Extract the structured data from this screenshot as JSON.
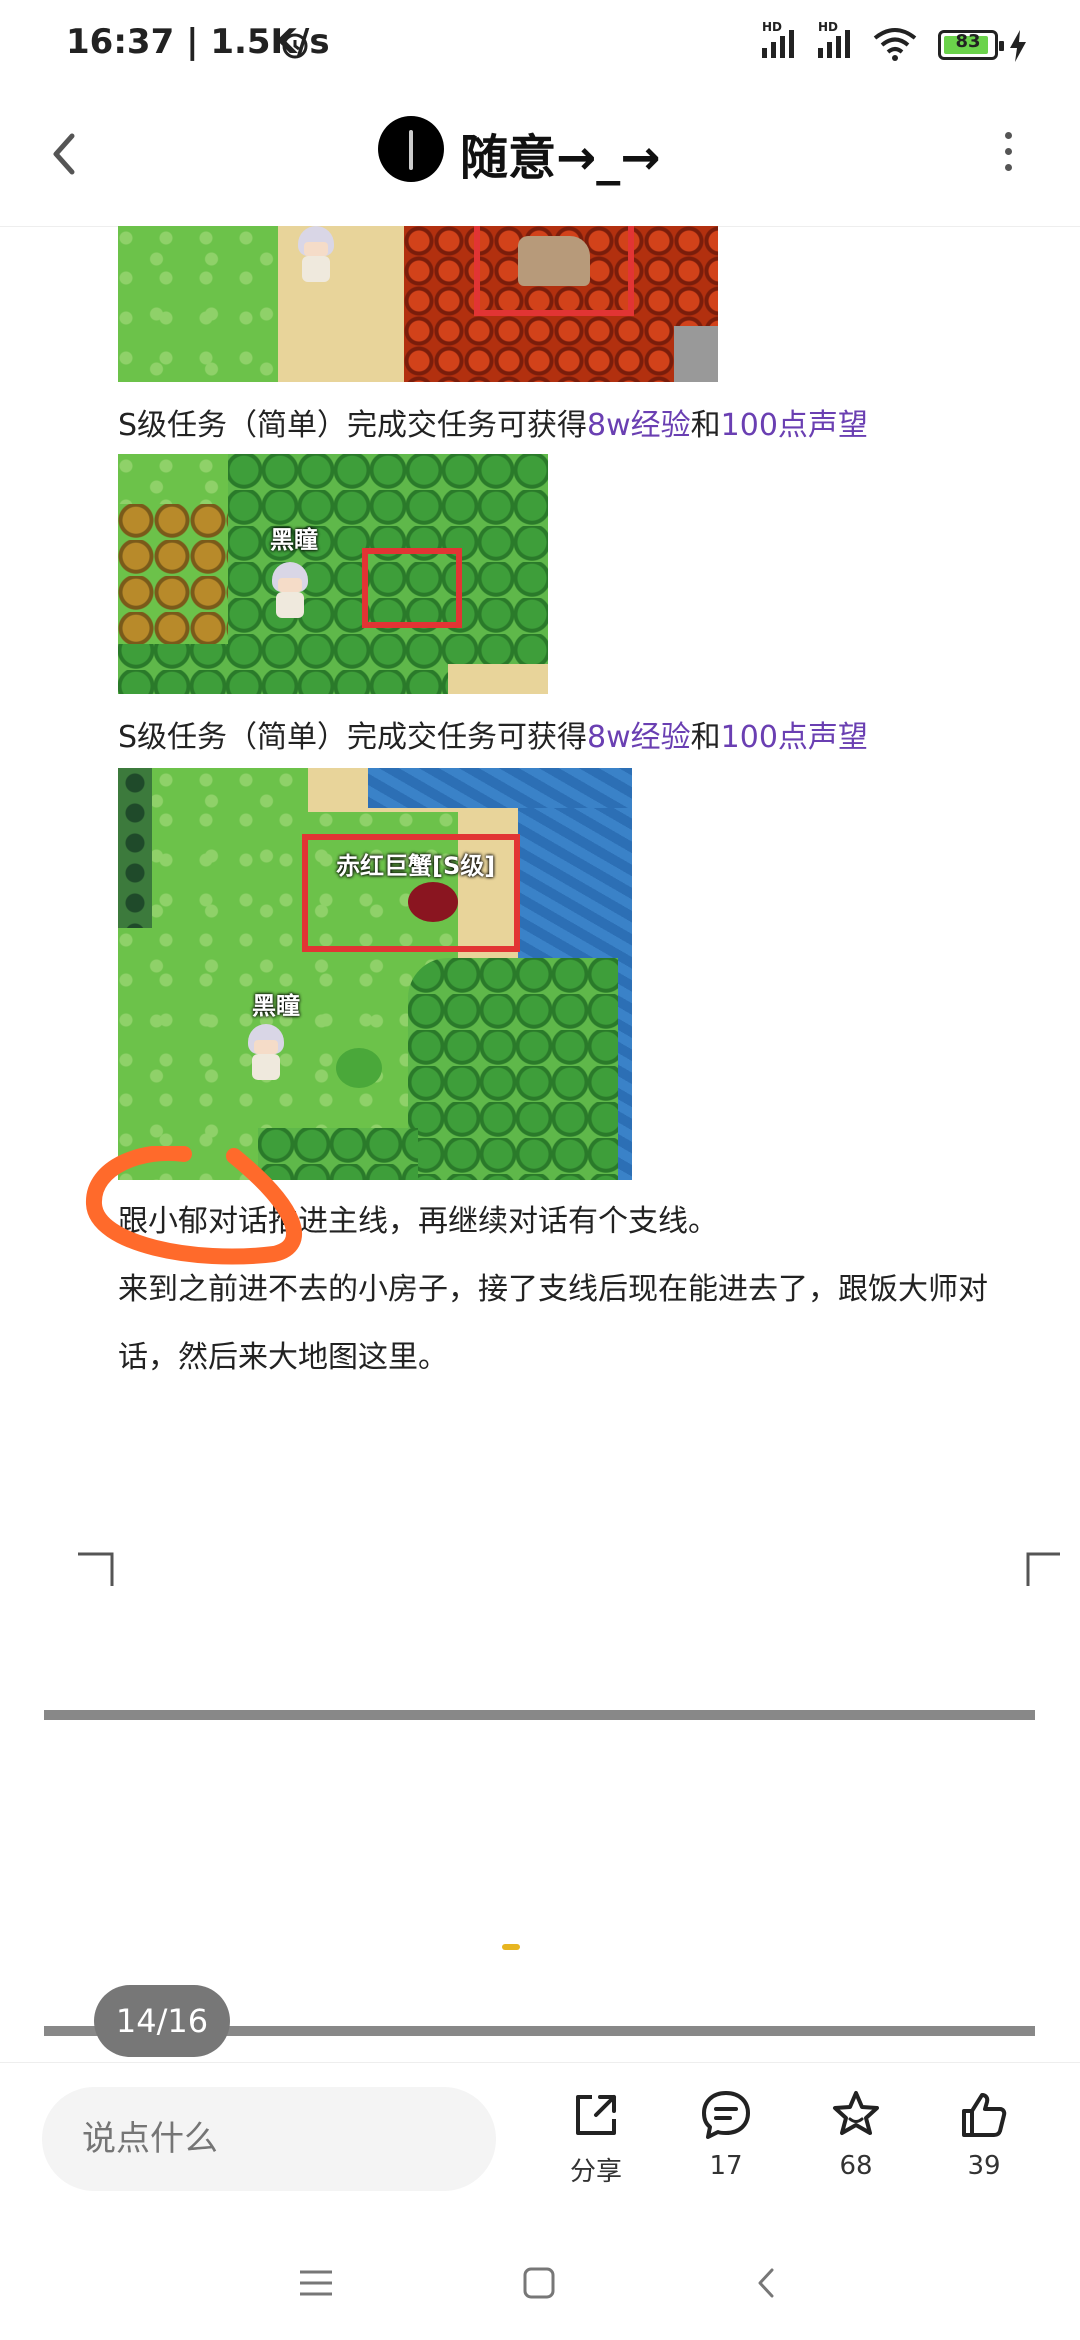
{
  "status_bar": {
    "time": "16:37 | 1.5K/s",
    "battery": "83",
    "icons": [
      "alarm-icon",
      "signal-hd-1-icon",
      "signal-hd-2-icon",
      "wifi-icon",
      "battery-icon",
      "charging-icon"
    ]
  },
  "header": {
    "title": "随意→_→",
    "icons": [
      "back-arrow-icon",
      "avatar",
      "more-vertical-icon"
    ]
  },
  "article": {
    "captions": [
      {
        "prefix": "S级任务（简单）完成交任务可获得",
        "hl1": "8w经验",
        "mid": "和",
        "hl2": "100点声望"
      },
      {
        "prefix": "S级任务（简单）完成交任务可获得",
        "hl1": "8w经验",
        "mid": "和",
        "hl2": "100点声望"
      }
    ],
    "image_labels": {
      "img2_npc": "黑瞳",
      "img3_enemy": "赤红巨蟹[S级]",
      "img3_npc": "黑瞳"
    },
    "paragraphs": [
      "跟小郁对话推进主线，再继续对话有个支线。",
      "来到之前进不去的小房子，接了支线后现在能进去了，跟饭大师对话，然后来大地图这里。"
    ]
  },
  "page_indicator": "14/16",
  "action_bar": {
    "comment_placeholder": "说点什么",
    "share_label": "分享",
    "comments_count": "17",
    "favorites_count": "68",
    "likes_count": "39"
  },
  "colors": {
    "highlight": "#6a3fb2",
    "annotation": "#ff6a2b",
    "battery_fill": "#6bd34b"
  }
}
